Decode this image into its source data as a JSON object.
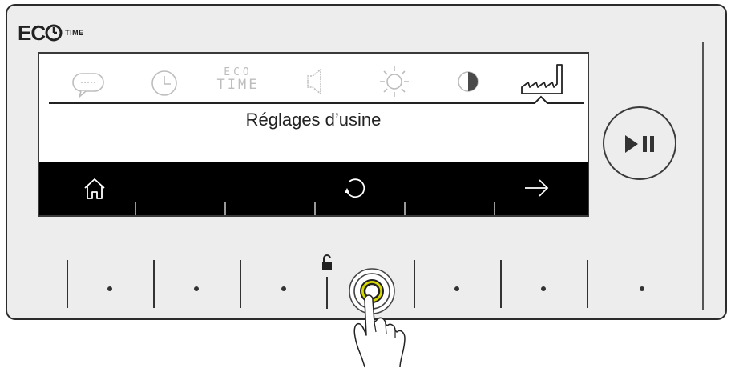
{
  "logo": {
    "brand": "EC",
    "suffix": "TIME"
  },
  "menu": {
    "eco_icon": {
      "line1": "ECO",
      "line2": "TIME"
    },
    "icons": [
      "chat-bubble-icon",
      "clock-icon",
      "eco-time-icon",
      "speaker-icon",
      "brightness-icon",
      "contrast-icon",
      "factory-icon"
    ],
    "selected": "factory-icon"
  },
  "screen": {
    "title": "Réglages d’usine"
  },
  "bottom_bar": {
    "icons": [
      "home-icon",
      "reset-icon",
      "arrow-right-icon"
    ]
  },
  "controls": {
    "play_pause_icon": "play-pause-icon",
    "lock_icon": "lock-icon"
  }
}
